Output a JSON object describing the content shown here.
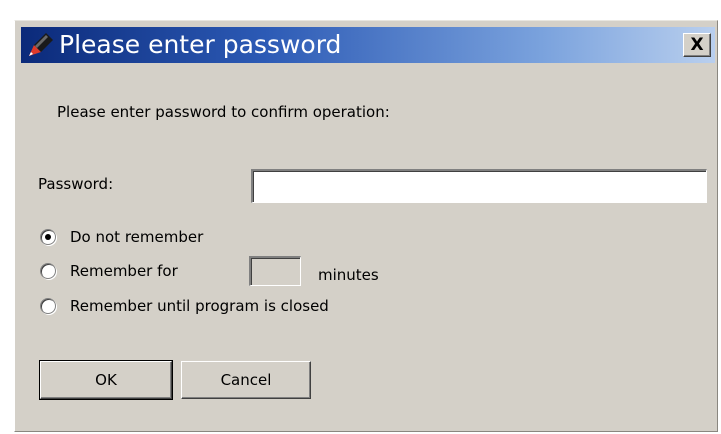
{
  "dialog": {
    "title": "Please enter password",
    "close_label": "X",
    "prompt": "Please enter password to confirm operation:",
    "password_label": "Password:",
    "password_value": "",
    "options": [
      {
        "label": "Do not remember",
        "checked": true
      },
      {
        "label": "Remember for",
        "checked": false
      },
      {
        "label": "Remember until program is closed",
        "checked": false
      }
    ],
    "minutes_value": "",
    "minutes_label": "minutes",
    "ok_label": "OK",
    "cancel_label": "Cancel"
  },
  "colors": {
    "face": "#d4d0c8",
    "title_start": "#0b2a7a",
    "title_end": "#b9cfee"
  }
}
